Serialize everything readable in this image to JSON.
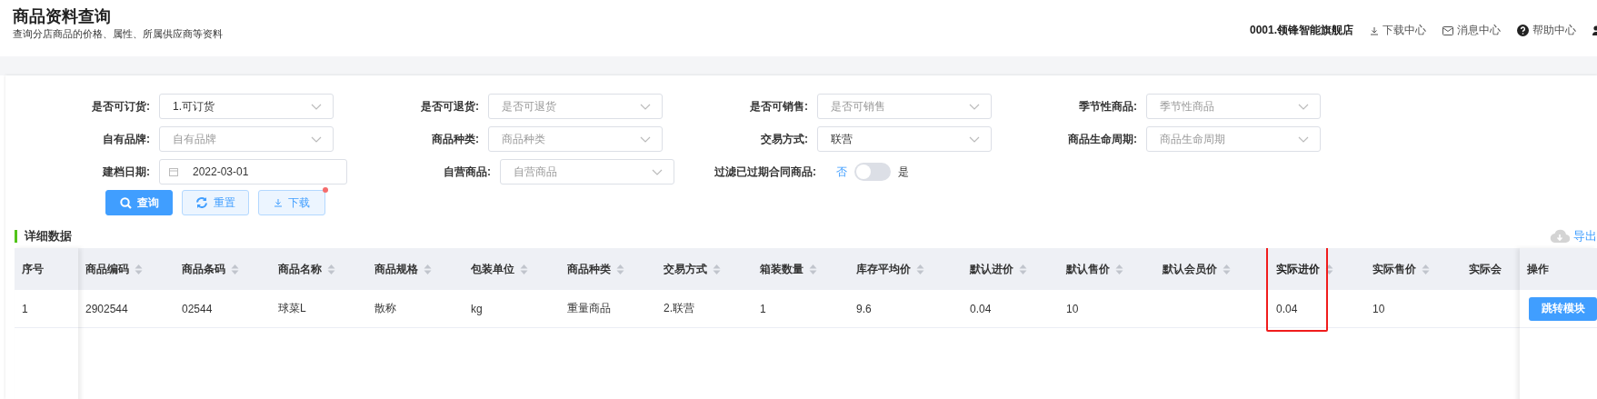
{
  "header": {
    "title": "商品资料查询",
    "subtitle": "查询分店商品的价格、属性、所属供应商等资料",
    "store": "0001.领锋智能旗舰店",
    "links": [
      {
        "label": "下载中心"
      },
      {
        "label": "消息中心"
      },
      {
        "label": "帮助中心"
      }
    ]
  },
  "filters": [
    {
      "label": "是否可订货:",
      "kind": "select",
      "value": "1.可订货"
    },
    {
      "label": "是否可退货:",
      "kind": "select",
      "placeholder": "是否可退货"
    },
    {
      "label": "是否可销售:",
      "kind": "select",
      "placeholder": "是否可销售"
    },
    {
      "label": "季节性商品:",
      "kind": "select",
      "placeholder": "季节性商品"
    },
    {
      "label": "自有品牌:",
      "kind": "select",
      "placeholder": "自有品牌"
    },
    {
      "label": "商品种类:",
      "kind": "select",
      "placeholder": "商品种类"
    },
    {
      "label": "交易方式:",
      "kind": "select",
      "value": "联营"
    },
    {
      "label": "商品生命周期:",
      "kind": "select",
      "placeholder": "商品生命周期"
    },
    {
      "label": "建档日期:",
      "kind": "date",
      "value": "2022-03-01"
    },
    {
      "label": "自营商品:",
      "kind": "select",
      "placeholder": "自营商品"
    },
    {
      "label": "过滤已过期合同商品:",
      "kind": "switch",
      "off_label": "否",
      "on_label": "是",
      "on": false
    }
  ],
  "buttons": [
    {
      "label": "查询",
      "kind": "primary"
    },
    {
      "label": "重置",
      "kind": "plain"
    },
    {
      "label": "下载",
      "kind": "plain",
      "dot": true
    }
  ],
  "section_title": "详细数据",
  "export_link": "导出",
  "table": {
    "columns": [
      {
        "label": "序号",
        "kind": "index",
        "sortable": false,
        "highlighted": false
      },
      {
        "label": "商品编码",
        "kind": "data",
        "sortable": true,
        "highlighted": false
      },
      {
        "label": "商品条码",
        "kind": "data",
        "sortable": true,
        "highlighted": false
      },
      {
        "label": "商品名称",
        "kind": "data",
        "sortable": true,
        "highlighted": false
      },
      {
        "label": "商品规格",
        "kind": "data",
        "sortable": true,
        "highlighted": false
      },
      {
        "label": "包装单位",
        "kind": "data",
        "sortable": true,
        "highlighted": false
      },
      {
        "label": "商品种类",
        "kind": "data",
        "sortable": true,
        "highlighted": false
      },
      {
        "label": "交易方式",
        "kind": "data",
        "sortable": true,
        "highlighted": false
      },
      {
        "label": "箱装数量",
        "kind": "data",
        "sortable": true,
        "highlighted": false
      },
      {
        "label": "库存平均价",
        "kind": "wide",
        "sortable": true,
        "highlighted": false
      },
      {
        "label": "默认进价",
        "kind": "data",
        "sortable": true,
        "highlighted": false
      },
      {
        "label": "默认售价",
        "kind": "data",
        "sortable": true,
        "highlighted": false
      },
      {
        "label": "默认会员价",
        "kind": "wide",
        "sortable": true,
        "highlighted": false
      },
      {
        "label": "实际进价",
        "kind": "data",
        "sortable": true,
        "highlighted": true
      },
      {
        "label": "实际售价",
        "kind": "data",
        "sortable": true,
        "highlighted": false
      },
      {
        "label": "实际会",
        "kind": "data",
        "sortable": false,
        "highlighted": false
      },
      {
        "label": "操作",
        "kind": "action",
        "sortable": false,
        "highlighted": false
      }
    ],
    "rows": [
      {
        "cells": [
          "1",
          "2902544",
          "02544",
          "球菜L",
          "散称",
          "kg",
          "重量商品",
          "2.联营",
          "1",
          "9.6",
          "0.04",
          "10",
          null,
          "0.04",
          "10",
          null,
          "跳转模块"
        ]
      }
    ]
  }
}
